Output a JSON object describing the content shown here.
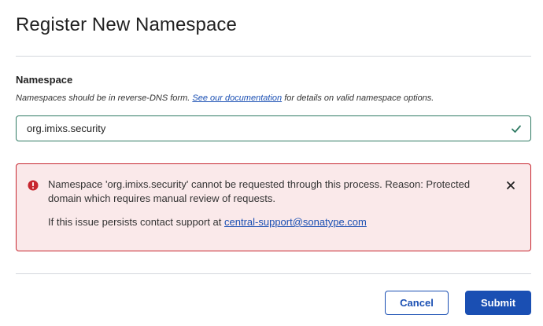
{
  "dialog": {
    "title": "Register New Namespace"
  },
  "field": {
    "label": "Namespace",
    "help_prefix": "Namespaces should be in reverse-DNS form.",
    "help_link": "See our documentation",
    "help_suffix": "for details on valid namespace options.",
    "value": "org.imixs.security",
    "status_icon": "check-icon"
  },
  "alert": {
    "icon": "error-icon",
    "message": "Namespace 'org.imixs.security' cannot be requested through this process. Reason: Protected domain which requires manual review of requests.",
    "support_prefix": "If this issue persists contact support at",
    "support_email": "central-support@sonatype.com",
    "close_icon": "close-icon"
  },
  "actions": {
    "cancel_label": "Cancel",
    "submit_label": "Submit"
  },
  "colors": {
    "accent": "#1a4fb3",
    "valid_border": "#2f7a63",
    "error": "#c7262f",
    "error_background": "#fae9ea"
  }
}
